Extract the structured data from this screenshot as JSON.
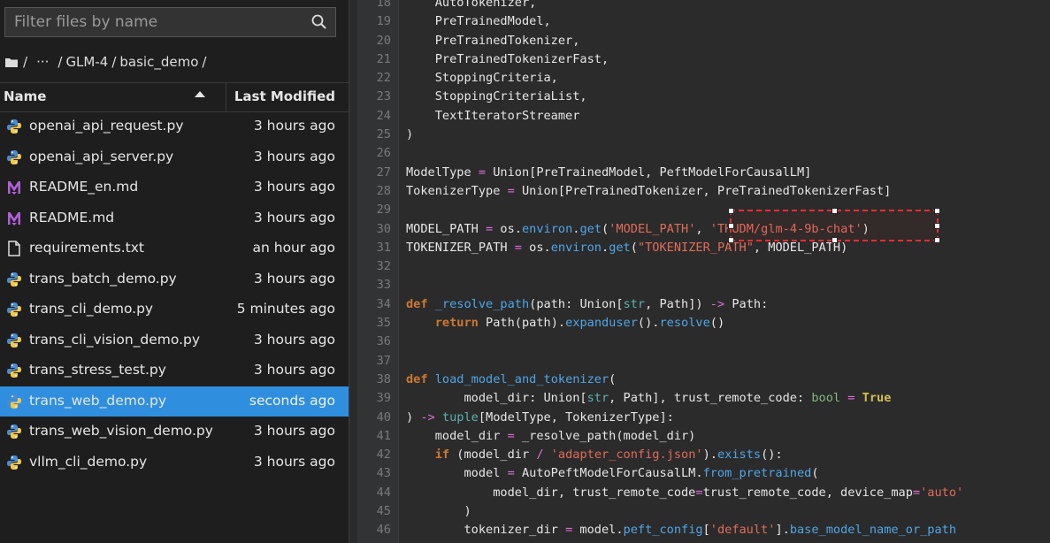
{
  "search": {
    "placeholder": "Filter files by name"
  },
  "breadcrumb": {
    "root": "/",
    "ellipsis": "···",
    "sep1": "/",
    "folder1": "GLM-4",
    "sep2": "/",
    "folder2": "basic_demo",
    "sep3": "/"
  },
  "header": {
    "name": "Name",
    "last_modified": "Last Modified"
  },
  "files": [
    {
      "name": "openai_api_request.py",
      "modified": "3 hours ago",
      "icon": "python"
    },
    {
      "name": "openai_api_server.py",
      "modified": "3 hours ago",
      "icon": "python"
    },
    {
      "name": "README_en.md",
      "modified": "3 hours ago",
      "icon": "markdown"
    },
    {
      "name": "README.md",
      "modified": "3 hours ago",
      "icon": "markdown"
    },
    {
      "name": "requirements.txt",
      "modified": "an hour ago",
      "icon": "text"
    },
    {
      "name": "trans_batch_demo.py",
      "modified": "3 hours ago",
      "icon": "python"
    },
    {
      "name": "trans_cli_demo.py",
      "modified": "5 minutes ago",
      "icon": "python"
    },
    {
      "name": "trans_cli_vision_demo.py",
      "modified": "3 hours ago",
      "icon": "python"
    },
    {
      "name": "trans_stress_test.py",
      "modified": "3 hours ago",
      "icon": "python"
    },
    {
      "name": "trans_web_demo.py",
      "modified": "seconds ago",
      "icon": "python",
      "selected": true
    },
    {
      "name": "trans_web_vision_demo.py",
      "modified": "3 hours ago",
      "icon": "python"
    },
    {
      "name": "vllm_cli_demo.py",
      "modified": "3 hours ago",
      "icon": "python"
    }
  ],
  "code_lines": [
    {
      "n": "18",
      "segs": [
        [
          "    AutoTokenizer,",
          ""
        ]
      ]
    },
    {
      "n": "19",
      "segs": [
        [
          "    PreTrainedModel,",
          ""
        ]
      ]
    },
    {
      "n": "20",
      "segs": [
        [
          "    PreTrainedTokenizer,",
          ""
        ]
      ]
    },
    {
      "n": "21",
      "segs": [
        [
          "    PreTrainedTokenizerFast,",
          ""
        ]
      ]
    },
    {
      "n": "22",
      "segs": [
        [
          "    StoppingCriteria,",
          ""
        ]
      ]
    },
    {
      "n": "23",
      "segs": [
        [
          "    StoppingCriteriaList,",
          ""
        ]
      ]
    },
    {
      "n": "24",
      "segs": [
        [
          "    TextIteratorStreamer",
          ""
        ]
      ]
    },
    {
      "n": "25",
      "segs": [
        [
          ")",
          ""
        ]
      ]
    },
    {
      "n": "26",
      "segs": []
    },
    {
      "n": "27",
      "segs": [
        [
          "ModelType ",
          ""
        ],
        [
          "=",
          "op"
        ],
        [
          " Union[PreTrainedModel, PeftModelForCausalLM]",
          ""
        ]
      ]
    },
    {
      "n": "28",
      "segs": [
        [
          "TokenizerType ",
          ""
        ],
        [
          "=",
          "op"
        ],
        [
          " Union[PreTrainedTokenizer, PreTrainedTokenizerFast]",
          ""
        ]
      ]
    },
    {
      "n": "29",
      "segs": []
    },
    {
      "n": "30",
      "segs": [
        [
          "MODEL_PATH ",
          ""
        ],
        [
          "=",
          "op"
        ],
        [
          " os.",
          ""
        ],
        [
          "environ",
          "fn"
        ],
        [
          ".",
          ""
        ],
        [
          "get",
          "fn"
        ],
        [
          "(",
          ""
        ],
        [
          "'MODEL_PATH'",
          "str"
        ],
        [
          ", ",
          ""
        ],
        [
          "'THUDM/glm-4-9b-chat'",
          "str"
        ],
        [
          ")",
          ""
        ]
      ]
    },
    {
      "n": "31",
      "segs": [
        [
          "TOKENIZER_PATH ",
          ""
        ],
        [
          "=",
          "op"
        ],
        [
          " os.",
          ""
        ],
        [
          "environ",
          "fn"
        ],
        [
          ".",
          ""
        ],
        [
          "get",
          "fn"
        ],
        [
          "(",
          ""
        ],
        [
          "\"TOKENIZER_PATH\"",
          "str"
        ],
        [
          ", MODEL_PATH)",
          ""
        ]
      ]
    },
    {
      "n": "32",
      "segs": []
    },
    {
      "n": "33",
      "segs": []
    },
    {
      "n": "34",
      "segs": [
        [
          "def",
          "kw"
        ],
        [
          " ",
          ""
        ],
        [
          "_resolve_path",
          "fn"
        ],
        [
          "(path: Union[",
          ""
        ],
        [
          "str",
          "bi"
        ],
        [
          ", Path]) ",
          ""
        ],
        [
          "->",
          "op"
        ],
        [
          " Path:",
          ""
        ]
      ]
    },
    {
      "n": "35",
      "segs": [
        [
          "    ",
          ""
        ],
        [
          "return",
          "kw"
        ],
        [
          " Path(path).",
          ""
        ],
        [
          "expanduser",
          "fn"
        ],
        [
          "().",
          ""
        ],
        [
          "resolve",
          "fn"
        ],
        [
          "()",
          ""
        ]
      ]
    },
    {
      "n": "36",
      "segs": []
    },
    {
      "n": "37",
      "segs": []
    },
    {
      "n": "38",
      "segs": [
        [
          "def",
          "kw"
        ],
        [
          " ",
          ""
        ],
        [
          "load_model_and_tokenizer",
          "fn"
        ],
        [
          "(",
          ""
        ]
      ]
    },
    {
      "n": "39",
      "segs": [
        [
          "        model_dir: Union[",
          ""
        ],
        [
          "str",
          "bi"
        ],
        [
          ", Path], trust_remote_code: ",
          ""
        ],
        [
          "bool",
          "tp"
        ],
        [
          " ",
          ""
        ],
        [
          "=",
          "op"
        ],
        [
          " ",
          ""
        ],
        [
          "True",
          "lit"
        ]
      ]
    },
    {
      "n": "40",
      "segs": [
        [
          ") ",
          ""
        ],
        [
          "->",
          "op"
        ],
        [
          " ",
          ""
        ],
        [
          "tuple",
          "bi"
        ],
        [
          "[ModelType, TokenizerType]:",
          ""
        ]
      ]
    },
    {
      "n": "41",
      "segs": [
        [
          "    model_dir ",
          ""
        ],
        [
          "=",
          "op"
        ],
        [
          " _resolve_path(model_dir)",
          ""
        ]
      ]
    },
    {
      "n": "42",
      "segs": [
        [
          "    ",
          ""
        ],
        [
          "if",
          "kw"
        ],
        [
          " (model_dir ",
          ""
        ],
        [
          "/",
          "op"
        ],
        [
          " ",
          ""
        ],
        [
          "'adapter_config.json'",
          "str"
        ],
        [
          ").",
          ""
        ],
        [
          "exists",
          "fn"
        ],
        [
          "():",
          ""
        ]
      ]
    },
    {
      "n": "43",
      "segs": [
        [
          "        model ",
          ""
        ],
        [
          "=",
          "op"
        ],
        [
          " AutoPeftModelForCausalLM.",
          ""
        ],
        [
          "from_pretrained",
          "fn"
        ],
        [
          "(",
          ""
        ]
      ]
    },
    {
      "n": "44",
      "segs": [
        [
          "            model_dir, trust_remote_code",
          ""
        ],
        [
          "=",
          "op"
        ],
        [
          "trust_remote_code, device_map",
          ""
        ],
        [
          "=",
          "op"
        ],
        [
          "'auto'",
          "str"
        ]
      ]
    },
    {
      "n": "45",
      "segs": [
        [
          "        )",
          ""
        ]
      ]
    },
    {
      "n": "46",
      "segs": [
        [
          "        tokenizer_dir ",
          ""
        ],
        [
          "=",
          "op"
        ],
        [
          " model.",
          ""
        ],
        [
          "peft_config",
          "fn"
        ],
        [
          "[",
          ""
        ],
        [
          "'default'",
          "str"
        ],
        [
          "].",
          ""
        ],
        [
          "base_model_name_or_path",
          "fn"
        ]
      ]
    }
  ]
}
